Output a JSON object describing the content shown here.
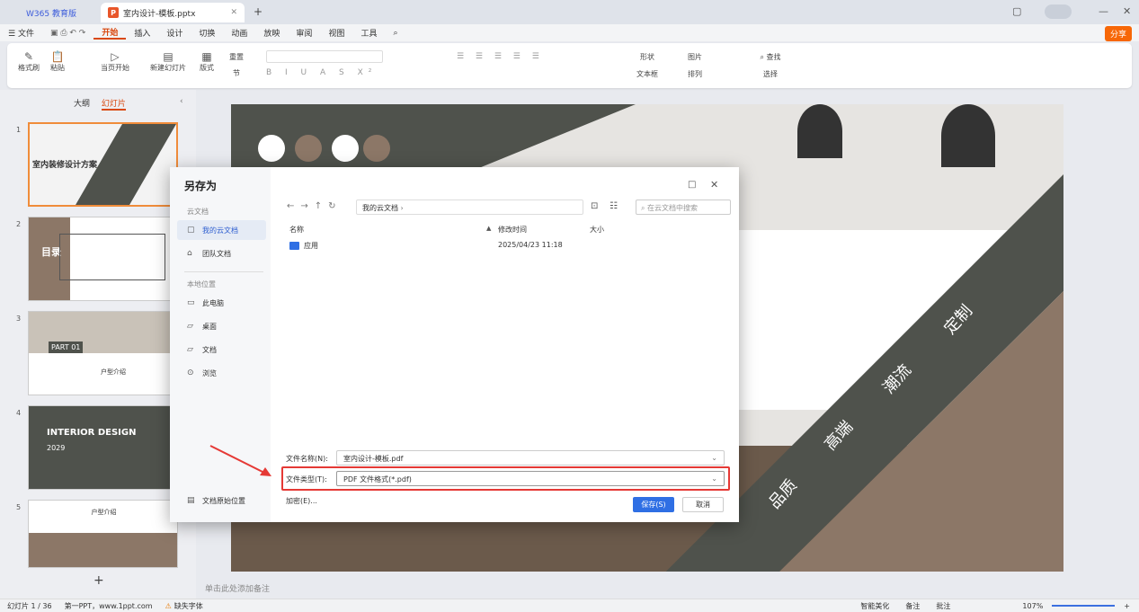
{
  "titlebar": {
    "home_tab": "W365 教育版",
    "doc_tab": "室内设计-模板.pptx",
    "doc_badge": "P"
  },
  "menubar": {
    "file": "文件",
    "items": [
      "开始",
      "插入",
      "设计",
      "切换",
      "动画",
      "放映",
      "审阅",
      "视图",
      "工具"
    ],
    "share": "分享"
  },
  "ribbon": {
    "format_painter": "格式刷",
    "paste": "粘贴",
    "from_current": "当页开始",
    "new_slide": "新建幻灯片",
    "layout": "版式",
    "section": "节",
    "reset": "重置",
    "shape": "形状",
    "picture": "图片",
    "textbox": "文本框",
    "arrange": "排列",
    "find": "查找",
    "select": "选择"
  },
  "leftpanel": {
    "tab_outline": "大纲",
    "tab_slides": "幻灯片",
    "thumbs": [
      {
        "num": "1",
        "title": "室内装修设计方案"
      },
      {
        "num": "2",
        "title": "目录"
      },
      {
        "num": "3",
        "title": "PART 01",
        "subtitle": "户型介绍"
      },
      {
        "num": "4",
        "title": "INTERIOR DESIGN",
        "subtitle": "2029"
      },
      {
        "num": "5",
        "title": "户型介绍"
      }
    ]
  },
  "slide": {
    "words": [
      "定制",
      "潮流",
      "高端",
      "品质"
    ]
  },
  "notes_placeholder": "单击此处添加备注",
  "statusbar": {
    "slide_count": "幻灯片 1 / 36",
    "theme": "第一PPT，www.1ppt.com",
    "missing_font": "缺失字体",
    "beautify": "智能美化",
    "notes": "备注",
    "comment": "批注",
    "zoom": "107%"
  },
  "dialog": {
    "title": "另存为",
    "side": {
      "cloud_head": "云文档",
      "my_cloud": "我的云文档",
      "team": "团队文档",
      "local_head": "本地位置",
      "this_pc": "此电脑",
      "desktop": "桌面",
      "documents": "文档",
      "browse": "浏览",
      "original_location": "文档原始位置"
    },
    "path": "我的云文档",
    "search_placeholder": "在云文档中搜索",
    "columns": {
      "name": "名称",
      "modified": "修改时间",
      "size": "大小"
    },
    "files": [
      {
        "name": "应用",
        "modified": "2025/04/23 11:18",
        "size": ""
      }
    ],
    "filename_label": "文件名称(N):",
    "filename_value": "室内设计-模板.pdf",
    "filetype_label": "文件类型(T):",
    "filetype_value": "PDF 文件格式(*.pdf)",
    "encrypt": "加密(E)...",
    "save": "保存(S)",
    "cancel": "取消"
  },
  "colors": {
    "accent": "#2f6fe4",
    "highlight": "#e53935",
    "slide_dark": "#4f524c",
    "slide_brown": "#8c7767"
  }
}
